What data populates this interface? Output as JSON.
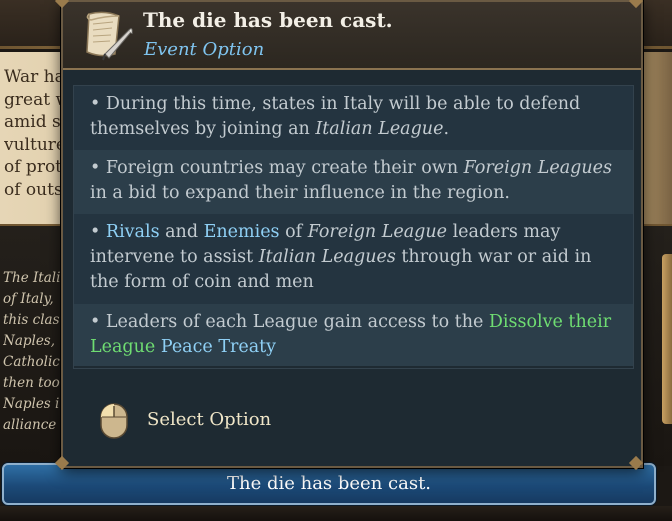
{
  "background": {
    "text_lines": [
      "War ha",
      "great w",
      "amid s",
      "vulture",
      "of prot",
      "of outs"
    ],
    "italic_lines": [
      "The Itali",
      "of Italy,",
      "this clas",
      "Naples,",
      "Catholic",
      "then too",
      "Naples i",
      "alliance"
    ]
  },
  "tooltip": {
    "title": "The die has been cast.",
    "subtitle": "Event Option",
    "icon": "scroll-quill-icon",
    "effects": [
      {
        "prefix": "• During this time, states in Italy will be able to defend themselves by joining an ",
        "em": "Italian League",
        "suffix": "."
      },
      {
        "prefix": "• Foreign countries may create their own ",
        "em": "Foreign Leagues",
        "suffix": " in a bid to expand their influence in the region."
      },
      {
        "bullet": "• ",
        "rivals": "Rivals",
        "and": " and ",
        "enemies": "Enemies",
        "of": " of ",
        "em1": "Foreign League",
        "mid": " leaders may intervene to assist ",
        "em2": "Italian Leagues",
        "suffix": " through war or aid in the form of coin and men"
      },
      {
        "prefix": "• Leaders of each League gain access to the ",
        "green": "Dissolve their League",
        "space": " ",
        "blue": "Peace Treaty"
      }
    ],
    "select_option": "Select Option",
    "select_icon": "mouse-left-click-icon"
  },
  "option_button": {
    "label": "The die has been cast."
  },
  "colors": {
    "title": "#f3efe6",
    "subtitle": "#7fc4ef",
    "keyword_blue": "#8fd0f5",
    "keyword_green": "#6fdd72",
    "button": "#1c4a78"
  }
}
